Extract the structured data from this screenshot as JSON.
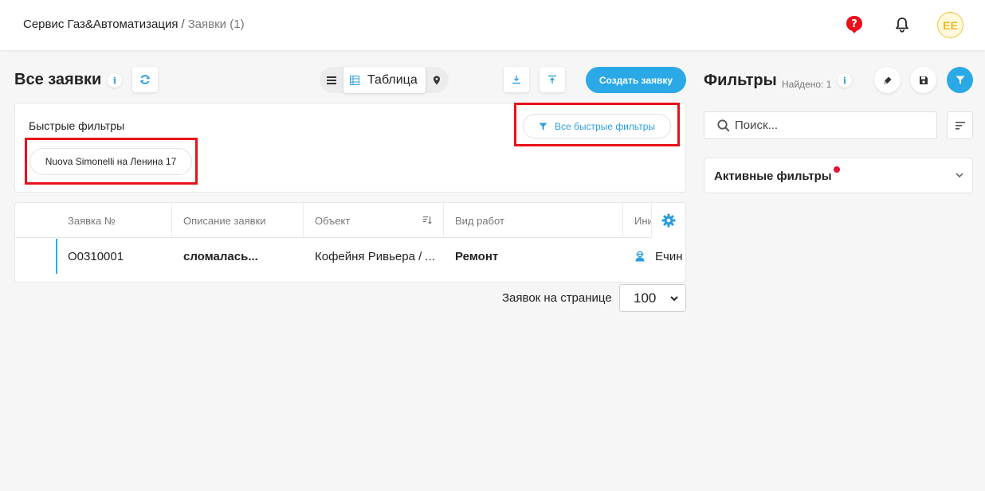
{
  "header": {
    "app_name": "Сервис Газ&Автоматизация",
    "separator": "/",
    "current_page": "Заявки (1)",
    "avatar_initials": "EE"
  },
  "toolbar": {
    "title": "Все заявки",
    "info_label": "i",
    "view_active_label": "Таблица",
    "create_label": "Создать заявку"
  },
  "quick_filters": {
    "title": "Быстрые фильтры",
    "all_label": "Все быстрые фильтры",
    "chips": [
      "Nuova Simonelli на Ленина 17"
    ]
  },
  "table": {
    "columns": [
      "Заявка №",
      "Описание заявки",
      "Объект",
      "Вид работ",
      "Ини"
    ],
    "rows": [
      {
        "number": "O0310001",
        "description": "сломалась...",
        "object": "Кофейня Ривьера / ...",
        "work_type": "Ремонт",
        "initiator": "Ечин"
      }
    ]
  },
  "pager": {
    "label": "Заявок на странице",
    "value": "100"
  },
  "filters_panel": {
    "title": "Фильтры",
    "found": "Найдено: 1",
    "info_label": "i",
    "search_placeholder": "Поиск...",
    "active_label": "Активные фильтры"
  },
  "colors": {
    "accent": "#2aa9e6",
    "highlight": "#e8111b",
    "avatar": "#f0c33c",
    "indicator": "#e8113a"
  },
  "icons": {
    "help": "help-circle-icon",
    "notifications": "bell-icon",
    "refresh": "refresh-icon",
    "list_view": "list-icon",
    "table_view": "table-icon",
    "map_view": "map-pin-icon",
    "export": "download-icon",
    "import": "upload-icon",
    "filter": "filter-icon",
    "settings": "gear-icon",
    "search": "search-icon",
    "clear": "eraser-icon",
    "save": "save-icon",
    "sort": "sort-icon",
    "expand": "chevron-down-icon",
    "user": "user-icon"
  }
}
